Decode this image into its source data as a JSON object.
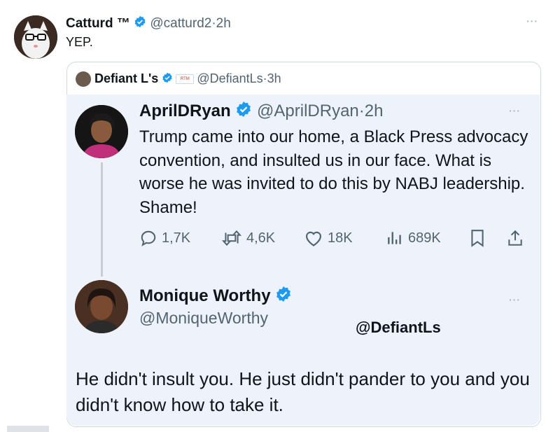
{
  "outer_tweet": {
    "name": "Catturd ™",
    "handle": "@catturd2",
    "time": "2h",
    "text": "YEP.",
    "more": "···"
  },
  "quote": {
    "name": "Defiant L's",
    "badge": "RTM",
    "handle": "@DefiantLs",
    "time": "3h",
    "tag": "@DefiantLs"
  },
  "april_tweet": {
    "name": "AprilDRyan",
    "handle": "@AprilDRyan",
    "time": "2h",
    "text": "Trump came into our home, a Black Press advocacy convention, and insulted us in our face. What is worse he was invited to do this by NABJ leadership. Shame!",
    "more": "···",
    "actions": {
      "replies": "1,7K",
      "retweets": "4,6K",
      "likes": "18K",
      "views": "689K"
    }
  },
  "monique_tweet": {
    "name": "Monique Worthy",
    "handle": "@MoniqueWorthy",
    "text": "He didn't insult you. He just didn't pander to you and you didn't know how to take it.",
    "more": "···"
  },
  "colors": {
    "verified": "#1d9bf0",
    "muted": "#536471",
    "inner_bg": "#eef3fb",
    "border": "#cfd9de"
  },
  "icons": [
    "verified-badge-icon",
    "reply-icon",
    "retweet-icon",
    "like-icon",
    "views-icon",
    "bookmark-icon",
    "share-icon",
    "more-icon"
  ]
}
